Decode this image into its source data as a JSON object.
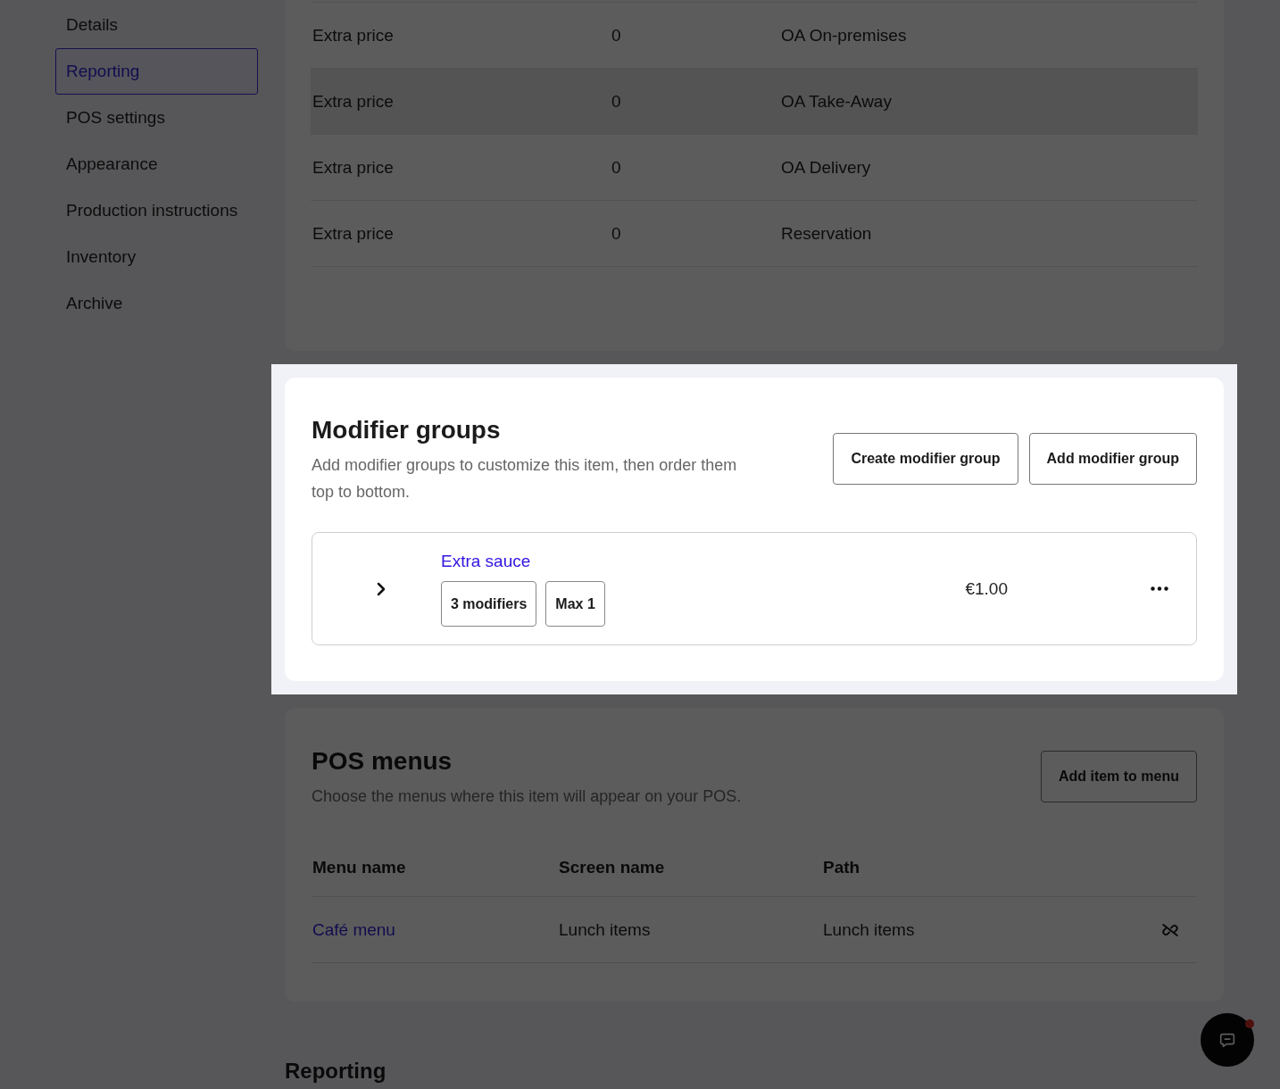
{
  "sidebar": {
    "items": [
      {
        "label": "Details",
        "selected": false
      },
      {
        "label": "Reporting",
        "selected": true
      },
      {
        "label": "POS settings",
        "selected": false
      },
      {
        "label": "Appearance",
        "selected": false
      },
      {
        "label": "Production instructions",
        "selected": false
      },
      {
        "label": "Inventory",
        "selected": false
      },
      {
        "label": "Archive",
        "selected": false
      }
    ]
  },
  "prices_table": {
    "rows": [
      {
        "cells": [
          "Extra price",
          "0",
          "OA On-premises"
        ],
        "hovered": false
      },
      {
        "cells": [
          "Extra price",
          "0",
          "OA Take-Away"
        ],
        "hovered": true
      },
      {
        "cells": [
          "Extra price",
          "0",
          "OA Delivery"
        ],
        "hovered": false
      },
      {
        "cells": [
          "Extra price",
          "0",
          "Reservation"
        ],
        "hovered": false
      }
    ]
  },
  "modifier_groups": {
    "title": "Modifier groups",
    "description": "Add modifier groups to customize this item, then order them top to bottom.",
    "spotlight": true,
    "buttons": [
      "Create modifier group",
      "Add modifier group"
    ],
    "groups": [
      {
        "name": "Extra sauce",
        "expanded": false,
        "chips": [
          "3 modifiers",
          "Max 1"
        ],
        "price": "€1.00"
      }
    ]
  },
  "pos_menus": {
    "title": "POS menus",
    "description": "Choose the menus where this item will appear on your POS.",
    "button": "Add item to menu",
    "columns": [
      "Menu name",
      "Screen name",
      "Path"
    ],
    "rows": [
      {
        "menu_name": "Café menu",
        "screen_name": "Lunch items",
        "path": "Lunch items"
      }
    ]
  },
  "reporting": {
    "title": "Reporting"
  },
  "chat": {
    "unread": true
  }
}
